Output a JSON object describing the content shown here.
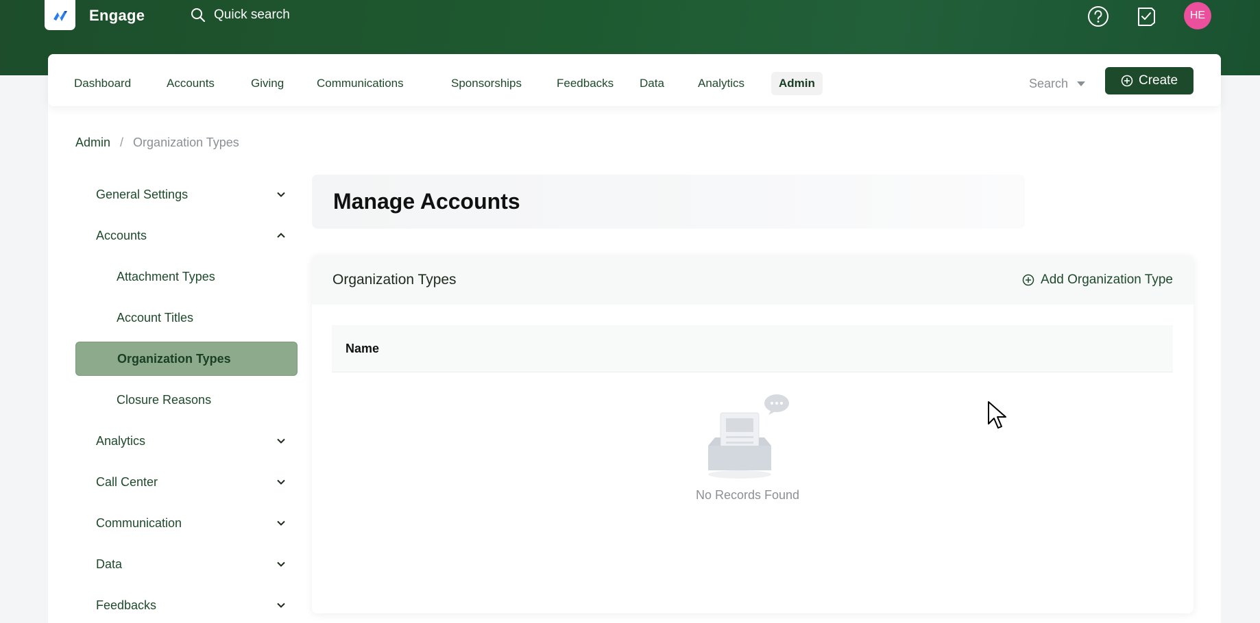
{
  "app": {
    "name": "Engage",
    "quick_search": "Quick search",
    "avatar_initials": "HE"
  },
  "nav": {
    "items": [
      "Dashboard",
      "Accounts",
      "Giving",
      "Communications",
      "Sponsorships",
      "Feedbacks",
      "Data",
      "Analytics",
      "Admin"
    ],
    "active": "Admin",
    "search_label": "Search",
    "create_label": "Create"
  },
  "breadcrumb": {
    "parent": "Admin",
    "separator": "/",
    "current": "Organization Types"
  },
  "sidebar": {
    "items": [
      {
        "label": "General Settings",
        "expanded": false
      },
      {
        "label": "Accounts",
        "expanded": true
      },
      {
        "label": "Attachment Types",
        "sub": true
      },
      {
        "label": "Account Titles",
        "sub": true
      },
      {
        "label": "Organization Types",
        "sub": true,
        "active": true
      },
      {
        "label": "Closure Reasons",
        "sub": true
      },
      {
        "label": "Analytics",
        "expanded": false
      },
      {
        "label": "Call Center",
        "expanded": false
      },
      {
        "label": "Communication",
        "expanded": false
      },
      {
        "label": "Data",
        "expanded": false
      },
      {
        "label": "Feedbacks",
        "expanded": false
      }
    ]
  },
  "main": {
    "page_title": "Manage Accounts",
    "card_title": "Organization Types",
    "add_label": "Add Organization Type",
    "table_header": "Name",
    "empty_text": "No Records Found"
  },
  "colors": {
    "brand_green": "#1c4a2a",
    "active_sidebar": "#8daa8d",
    "avatar": "#ec4f9c"
  }
}
